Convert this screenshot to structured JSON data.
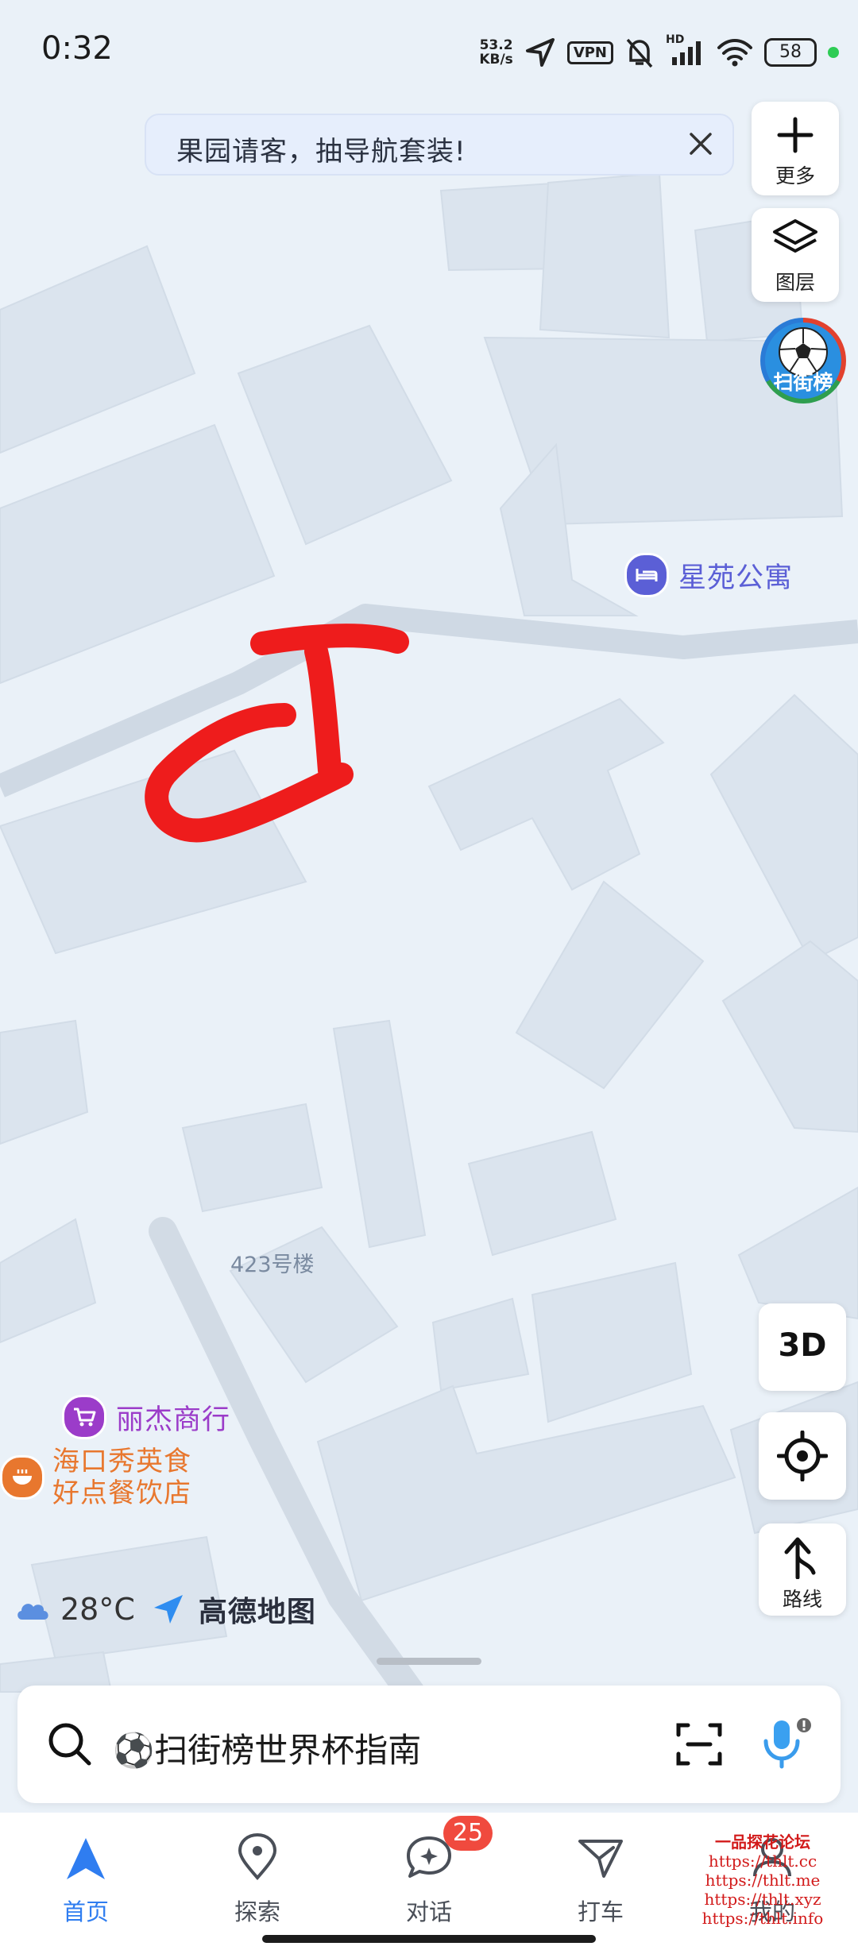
{
  "status_bar": {
    "time": "0:32",
    "net_speed": "53.2",
    "net_unit": "KB/s",
    "vpn": "VPN",
    "hd": "HD",
    "battery": "58"
  },
  "banner": {
    "text": "果园请客，抽导航套装!"
  },
  "right_controls": {
    "more_label": "更多",
    "layers_label": "图层",
    "promo_label": "扫街榜",
    "threed_label": "3D",
    "route_label": "路线"
  },
  "map": {
    "pois": {
      "apartment": "星苑公寓",
      "building": "423号楼",
      "shop": "丽杰商行",
      "restaurant_line1": "海口秀英食",
      "restaurant_line2": "好点餐饮店"
    },
    "accent_colors": {
      "apartment": "#5b5fd6",
      "shop": "#9b3cc9",
      "restaurant": "#e8772e",
      "annotation": "#ee1c1c"
    }
  },
  "weather": {
    "temperature": "28°C",
    "brand": "高德地图"
  },
  "search": {
    "text": "⚽扫街榜世界杯指南"
  },
  "tabs": [
    {
      "label": "首页",
      "active": true
    },
    {
      "label": "探索"
    },
    {
      "label": "对话",
      "badge": "25"
    },
    {
      "label": "打车"
    },
    {
      "label": "我的"
    }
  ],
  "watermark": {
    "title": "一品探花论坛",
    "lines": [
      "https://thlt.cc",
      "https://thlt.me",
      "https://thlt.xyz",
      "https://thlt.info"
    ]
  }
}
